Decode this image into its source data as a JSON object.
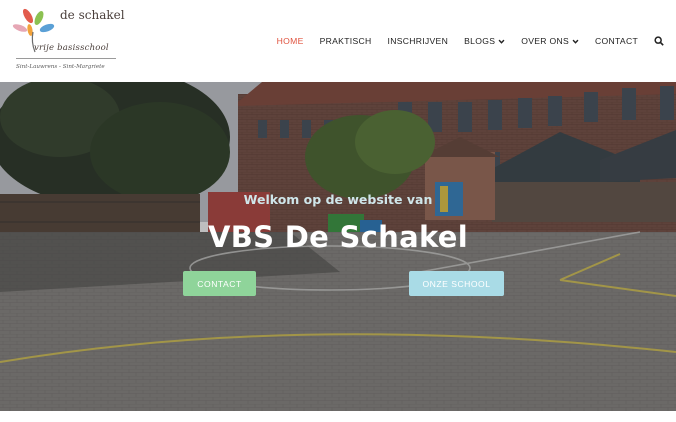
{
  "header": {
    "logo": {
      "title": "de schakel",
      "subtitle": "vrije basisschool",
      "locations": "Sint-Lauwrens - Sint-Margriete"
    },
    "nav": [
      {
        "label": "HOME",
        "active": true,
        "dropdown": false
      },
      {
        "label": "PRAKTISCH",
        "active": false,
        "dropdown": false
      },
      {
        "label": "INSCHRIJVEN",
        "active": false,
        "dropdown": false
      },
      {
        "label": "BLOGS",
        "active": false,
        "dropdown": true
      },
      {
        "label": "OVER ONS",
        "active": false,
        "dropdown": true
      },
      {
        "label": "CONTACT",
        "active": false,
        "dropdown": false
      }
    ],
    "search_icon": "search-icon",
    "active_color": "#e0533f"
  },
  "hero": {
    "subtitle": "Welkom op de website van",
    "title": "VBS De Schakel",
    "buttons": {
      "contact": "CONTACT",
      "school": "ONZE SCHOOL"
    },
    "colors": {
      "contact_button": "#8fd49a",
      "school_button": "#a9dbe6"
    }
  }
}
